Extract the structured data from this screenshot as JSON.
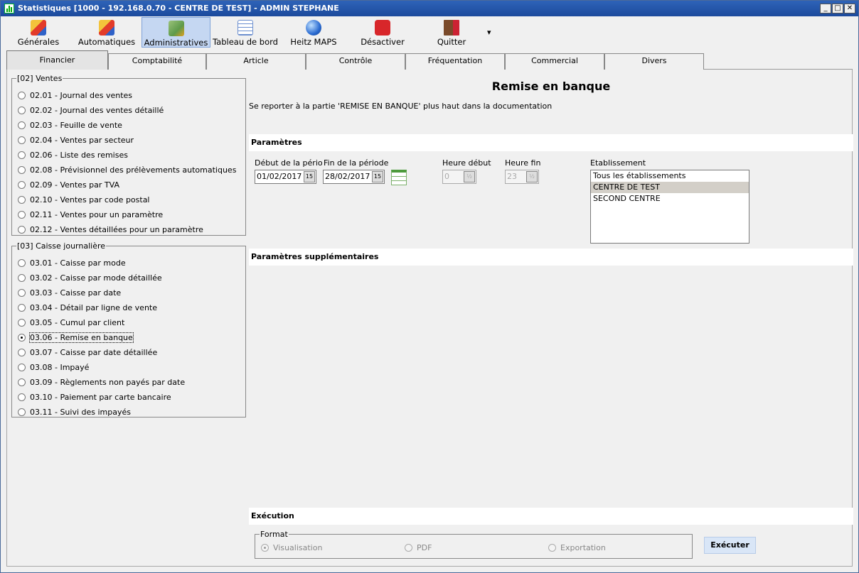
{
  "window": {
    "title": "Statistiques [1000 - 192.168.0.70 - CENTRE DE TEST] - ADMIN STEPHANE",
    "buttons": {
      "minimize": "_",
      "maximize": "□",
      "close": "✕"
    }
  },
  "toolbar": {
    "items": [
      {
        "label": "Générales",
        "icon": "chart-icon"
      },
      {
        "label": "Automatiques",
        "icon": "auto-chart-icon"
      },
      {
        "label": "Administratives",
        "icon": "admin-chart-icon"
      },
      {
        "label": "Tableau de bord",
        "icon": "dashboard-icon"
      },
      {
        "label": "Heitz MAPS",
        "icon": "globe-icon"
      },
      {
        "label": "Désactiver",
        "icon": "power-icon"
      },
      {
        "label": "Quitter",
        "icon": "exit-door-icon"
      }
    ],
    "more": "▾",
    "active_index": 2
  },
  "tabs": [
    "Financier",
    "Comptabilité",
    "Article",
    "Contrôle",
    "Fréquentation",
    "Commercial",
    "Divers"
  ],
  "selected_tab": "Financier",
  "groups": {
    "ventes": {
      "title": "[02] Ventes",
      "items": [
        "02.01 - Journal des ventes",
        "02.02 - Journal des ventes détaillé",
        "02.03 - Feuille de vente",
        "02.04 - Ventes par secteur",
        "02.06 - Liste des remises",
        "02.08 - Prévisionnel des prélèvements automatiques",
        "02.09 - Ventes par TVA",
        "02.10 - Ventes par code postal",
        "02.11 - Ventes pour un paramètre",
        "02.12 - Ventes détaillées pour un paramètre"
      ]
    },
    "caisse": {
      "title": "[03] Caisse journalière",
      "items": [
        "03.01 - Caisse par mode",
        "03.02 - Caisse par mode détaillée",
        "03.03 - Caisse par date",
        "03.04 - Détail par ligne de vente",
        "03.05 - Cumul par client",
        "03.06 - Remise en banque",
        "03.07 - Caisse par date détaillée",
        "03.08 - Impayé",
        "03.09 - Règlements non payés par date",
        "03.10 - Paiement par carte bancaire",
        "03.11 - Suivi des impayés"
      ],
      "selected": "03.06 - Remise en banque"
    }
  },
  "report": {
    "title": "Remise en banque",
    "description": "Se reporter à la partie 'REMISE EN BANQUE' plus haut dans la documentation"
  },
  "params": {
    "section_title": "Paramètres",
    "start_label": "Début de la pério",
    "start_value": "01/02/2017",
    "end_label": "Fin de la période",
    "end_value": "28/02/2017",
    "hour_start_label": "Heure début",
    "hour_start_value": "0",
    "hour_end_label": "Heure fin",
    "hour_end_value": "23",
    "date_spin": "15",
    "hour_spin": "½",
    "estab_label": "Etablissement",
    "estab_options": [
      "Tous les établissements",
      "CENTRE DE TEST",
      "SECOND CENTRE"
    ],
    "estab_selected": "CENTRE DE TEST"
  },
  "extra": {
    "section_title": "Paramètres supplémentaires"
  },
  "execution": {
    "section_title": "Exécution",
    "format_label": "Format",
    "formats": [
      "Visualisation",
      "PDF",
      "Exportation"
    ],
    "selected_format": "Visualisation",
    "button_label": "Exécuter"
  },
  "colors": {
    "titlebar": "#1c4a9c",
    "toolbar_active": "#c5d7f2",
    "exec_button": "#d9e6f7",
    "list_selected": "#d3cfc8"
  }
}
